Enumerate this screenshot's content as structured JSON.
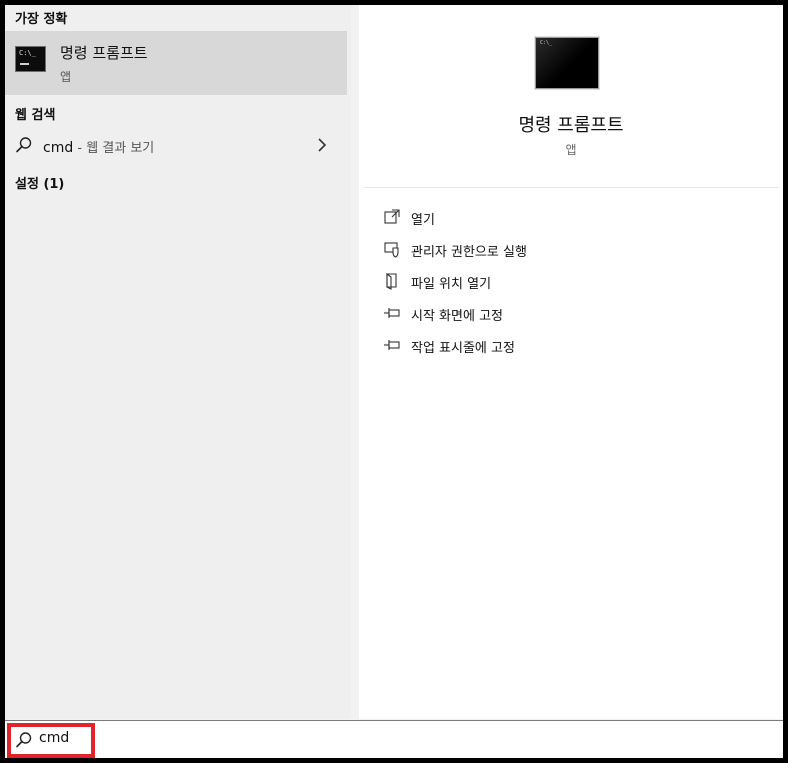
{
  "results": {
    "best_match_header": "가장 정확",
    "best_match": {
      "icon": "command-prompt-icon",
      "title": "명령 프롬프트",
      "subtitle": "앱"
    },
    "web_search_header": "웹 검색",
    "web_search": {
      "query": "cmd",
      "hint": " - 웹 결과 보기"
    },
    "settings_header": "설정 (1)"
  },
  "preview": {
    "icon": "command-prompt-icon",
    "title": "명령 프롬프트",
    "subtitle": "앱",
    "actions": [
      {
        "icon": "open-icon",
        "label": "열기"
      },
      {
        "icon": "run-as-admin-icon",
        "label": "관리자 권한으로 실행"
      },
      {
        "icon": "file-location-icon",
        "label": "파일 위치 열기"
      },
      {
        "icon": "pin-icon",
        "label": "시작 화면에 고정"
      },
      {
        "icon": "pin-icon",
        "label": "작업 표시줄에 고정"
      }
    ]
  },
  "search_bar": {
    "value": "cmd"
  },
  "colors": {
    "highlight": "#e0242b",
    "selected_row": "#d8d8d8",
    "left_bg": "#efefef",
    "right_bg": "#ffffff"
  }
}
